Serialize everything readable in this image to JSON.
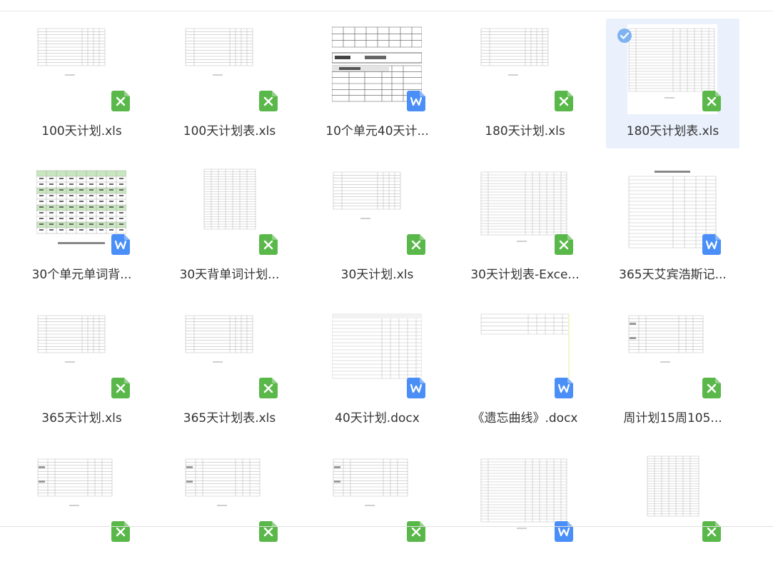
{
  "files": [
    {
      "name": "100天计划.xls",
      "type": "xls",
      "thumb": "sheet-small"
    },
    {
      "name": "100天计划表.xls",
      "type": "xls",
      "thumb": "sheet-small"
    },
    {
      "name": "10个单元40天计...",
      "type": "docx",
      "thumb": "word-table"
    },
    {
      "name": "180天计划.xls",
      "type": "xls",
      "thumb": "sheet-small"
    },
    {
      "name": "180天计划表.xls",
      "type": "xls",
      "thumb": "sheet-tall",
      "selected": true
    },
    {
      "name": "30个单元单词背...",
      "type": "docx",
      "thumb": "green-table"
    },
    {
      "name": "30天背单词计划...",
      "type": "xls",
      "thumb": "sheet-narrow"
    },
    {
      "name": "30天计划.xls",
      "type": "xls",
      "thumb": "sheet-small"
    },
    {
      "name": "30天计划表-Exce...",
      "type": "xls",
      "thumb": "sheet-tall"
    },
    {
      "name": "365天艾宾浩斯记...",
      "type": "docx",
      "thumb": "word-doc"
    },
    {
      "name": "365天计划.xls",
      "type": "xls",
      "thumb": "sheet-small"
    },
    {
      "name": "365天计划表.xls",
      "type": "xls",
      "thumb": "sheet-small"
    },
    {
      "name": "40天计划.docx",
      "type": "docx",
      "thumb": "word-grid"
    },
    {
      "name": "《遗忘曲线》.docx",
      "type": "docx",
      "thumb": "word-wide"
    },
    {
      "name": "周计划15周105...",
      "type": "xls",
      "thumb": "sheet-label"
    },
    {
      "name": "",
      "type": "xls",
      "thumb": "sheet-label"
    },
    {
      "name": "",
      "type": "xls",
      "thumb": "sheet-label"
    },
    {
      "name": "",
      "type": "xls",
      "thumb": "sheet-label"
    },
    {
      "name": "",
      "type": "docx",
      "thumb": "sheet-tall"
    },
    {
      "name": "",
      "type": "xls",
      "thumb": "sheet-narrow"
    }
  ],
  "colors": {
    "xls": "#5ab84a",
    "docx": "#4a8ff7",
    "selected_bg": "#eaf1fc",
    "check": "#7fb2f0"
  },
  "icons": {
    "xls": "excel-file-icon",
    "docx": "word-file-icon",
    "check": "checkmark-circle-icon"
  }
}
